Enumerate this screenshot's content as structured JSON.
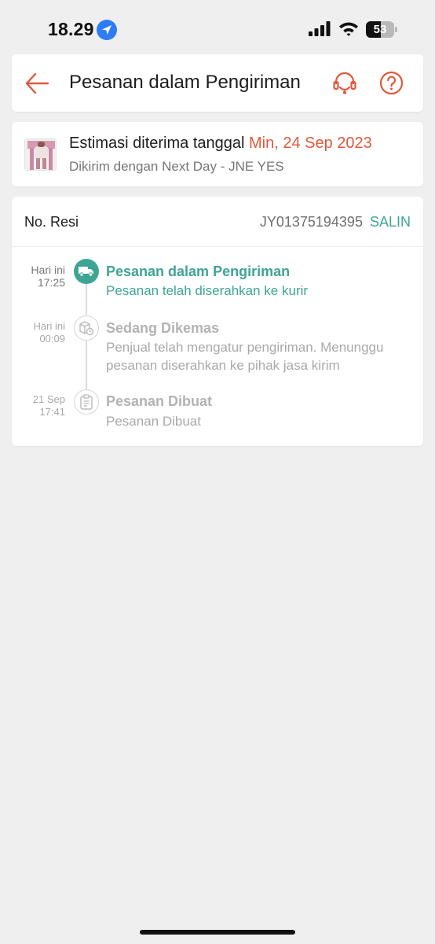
{
  "status_bar": {
    "time": "18.29",
    "battery_level": "53",
    "battery_fraction": 0.53
  },
  "header": {
    "title": "Pesanan dalam Pengiriman",
    "back_icon": "arrow-left-icon",
    "support_icon": "headset-icon",
    "help_icon": "question-circle-icon"
  },
  "estimate": {
    "label": "Estimasi diterima tanggal",
    "date": "Min, 24 Sep 2023",
    "courier": "Dikirim dengan Next Day - JNE YES"
  },
  "tracking": {
    "resi_label": "No. Resi",
    "resi_number": "JY01375194395",
    "copy_label": "SALIN",
    "events": [
      {
        "date_line1": "Hari ini",
        "date_line2": "17:25",
        "title": "Pesanan dalam Pengiriman",
        "description": "Pesanan telah diserahkan ke kurir",
        "icon": "truck-icon",
        "active": true
      },
      {
        "date_line1": "Hari ini",
        "date_line2": "00:09",
        "title": "Sedang Dikemas",
        "description": "Penjual telah mengatur pengiriman. Menunggu pesanan diserahkan ke pihak jasa kirim",
        "icon": "package-clock-icon",
        "active": false
      },
      {
        "date_line1": "21 Sep",
        "date_line2": "17:41",
        "title": "Pesanan Dibuat",
        "description": "Pesanan Dibuat",
        "icon": "clipboard-icon",
        "active": false
      }
    ]
  },
  "colors": {
    "accent_orange": "#e0593a",
    "accent_teal": "#3ea594",
    "background": "#efefef"
  }
}
